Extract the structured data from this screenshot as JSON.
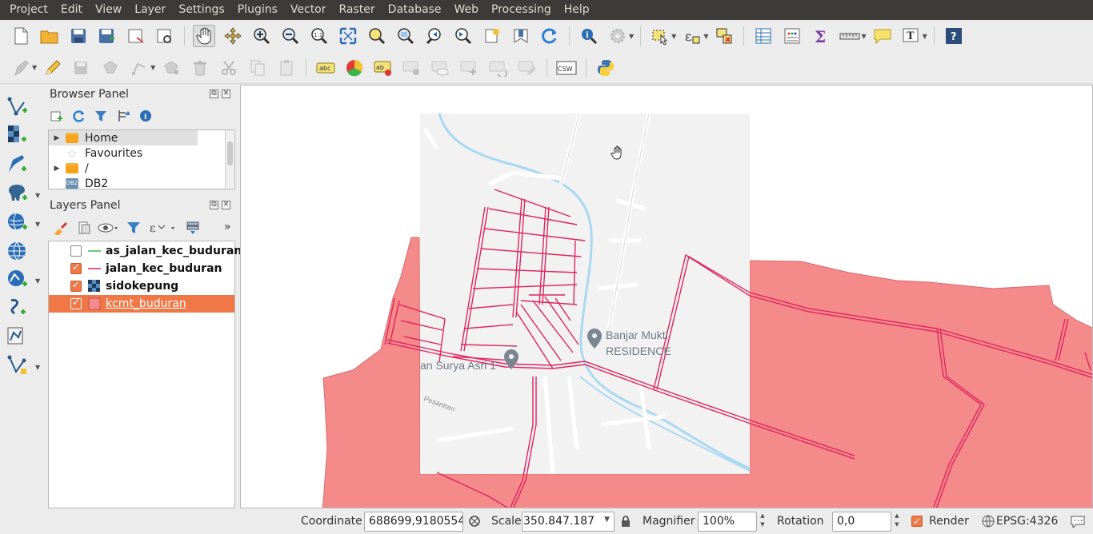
{
  "menu": [
    "Project",
    "Edit",
    "View",
    "Layer",
    "Settings",
    "Plugins",
    "Vector",
    "Raster",
    "Database",
    "Web",
    "Processing",
    "Help"
  ],
  "browser_panel": {
    "title": "Browser Panel",
    "items": [
      {
        "label": "Home",
        "icon": "folder-icon",
        "expandable": true
      },
      {
        "label": "Favourites",
        "icon": "star-icon",
        "expandable": false
      },
      {
        "label": "/",
        "icon": "folder-icon",
        "expandable": true
      },
      {
        "label": "DB2",
        "icon": "db2-icon",
        "expandable": false
      }
    ]
  },
  "layers_panel": {
    "title": "Layers Panel",
    "layers": [
      {
        "name": "as_jalan_kec_buduran",
        "checked": false,
        "symbol": "green-line",
        "color": "#3bb54a"
      },
      {
        "name": "jalan_kec_buduran",
        "checked": true,
        "symbol": "red-line",
        "color": "#e0245e"
      },
      {
        "name": "sidokepung",
        "checked": true,
        "symbol": "raster-icon",
        "color": "#1f3d5c"
      },
      {
        "name": "kcmt_buduran",
        "checked": true,
        "symbol": "polygon-fill",
        "color": "#f58a8a",
        "selected": true
      }
    ]
  },
  "map": {
    "labels": {
      "poi1_line1": "Banjar Mukti",
      "poi1_line2": "RESIDENCE",
      "street1": "an Surya Asri 1",
      "street2": "Pesantren"
    },
    "colors": {
      "polygon_fill": "#f58a8a",
      "road": "#e0245e",
      "basemap": "#f2f2f2",
      "river": "#aad8f0"
    }
  },
  "status": {
    "coordinate_label": "Coordinate",
    "coordinate_value": "688699,9180554",
    "scale_label": "Scale",
    "scale_value": "350.847.187",
    "magnifier_label": "Magnifier",
    "magnifier_value": "100%",
    "rotation_label": "Rotation",
    "rotation_value": "0,0",
    "render_label": "Render",
    "render_checked": true,
    "crs_label": "EPSG:4326"
  },
  "toolbar_labels": {
    "abc": "abc",
    "csw": "CSW",
    "text_tool": "T"
  }
}
